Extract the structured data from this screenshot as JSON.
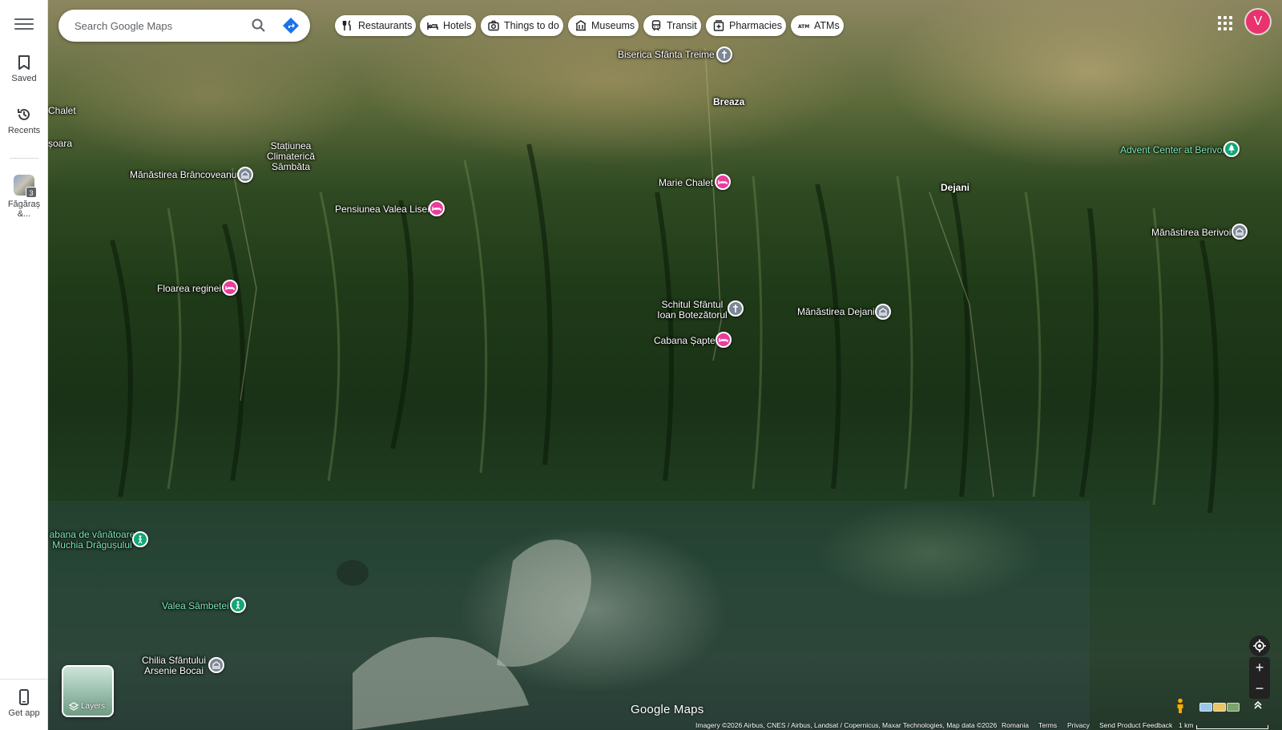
{
  "rail": {
    "saved_label": "Saved",
    "recents_label": "Recents",
    "recent_place_label": "Făgăraș &...",
    "recent_badge": "3",
    "get_app_label": "Get app"
  },
  "search": {
    "placeholder": "Search Google Maps"
  },
  "chips": [
    {
      "label": "Restaurants",
      "icon": "fork-knife-icon"
    },
    {
      "label": "Hotels",
      "icon": "bed-icon"
    },
    {
      "label": "Things to do",
      "icon": "camera-icon"
    },
    {
      "label": "Museums",
      "icon": "museum-icon"
    },
    {
      "label": "Transit",
      "icon": "train-icon"
    },
    {
      "label": "Pharmacies",
      "icon": "pharmacy-icon"
    },
    {
      "label": "ATMs",
      "icon": "atm-icon"
    }
  ],
  "account": {
    "initial": "V",
    "color": "#e8336f"
  },
  "places": {
    "biserica": "Biserica Sfânta Treime",
    "breaza": "Breaza",
    "chalet": "Chalet",
    "soara": "șoara",
    "statiunea_1": "Stațiunea",
    "statiunea_2": "Climaterică",
    "statiunea_3": "Sâmbăta",
    "brancoveanu": "Mănăstirea Brâncoveanu",
    "valea_lisei": "Pensiunea Valea Lisei",
    "marie_chalet": "Marie Chalet",
    "dejani_town": "Dejani",
    "advent": "Advent Center at Berivoi",
    "berivoi": "Mănăstirea Berivoi",
    "floarea": "Floarea reginei",
    "schitul_1": "Schitul Sfântul",
    "schitul_2": "Ioan Botezătorul",
    "dejani_monastery": "Mănăstirea Dejani",
    "cabana_sapte": "Cabana Șapte",
    "cabana_vanatoare_1": "abana de vânătoare",
    "cabana_vanatoare_2": "Muchia Drăgușului",
    "valea_sambetei": "Valea Sâmbetei",
    "chilia_1": "Chilia Sfântului",
    "chilia_2": "Arsenie Bocai"
  },
  "map": {
    "brand": "Google Maps",
    "layers_label": "Layers",
    "zoom_in": "+",
    "zoom_out": "−"
  },
  "footer": {
    "attribution": "Imagery ©2026 Airbus, CNES / Airbus, Landsat / Copernicus, Maxar Technologies, Map data ©2026",
    "country": "Romania",
    "terms": "Terms",
    "privacy": "Privacy",
    "feedback": "Send Product Feedback",
    "scale": "1 km"
  }
}
